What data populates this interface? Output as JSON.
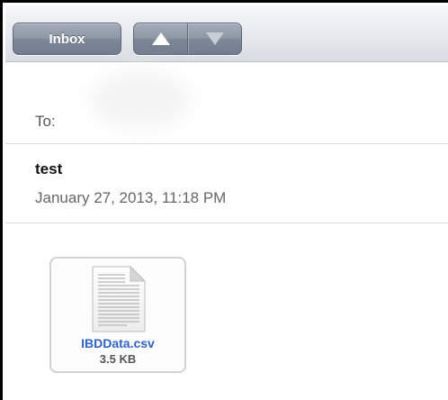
{
  "toolbar": {
    "inbox_label": "Inbox",
    "prev_icon": "arrow-up-icon",
    "next_icon": "arrow-down-icon"
  },
  "header": {
    "to_label": "To:",
    "subject": "test",
    "date": "January 27, 2013, 11:18 PM"
  },
  "attachment": {
    "icon": "csv-file-icon",
    "filename": "IBDData.csv",
    "size": "3.5 KB",
    "name_color": "#2e63c8"
  }
}
